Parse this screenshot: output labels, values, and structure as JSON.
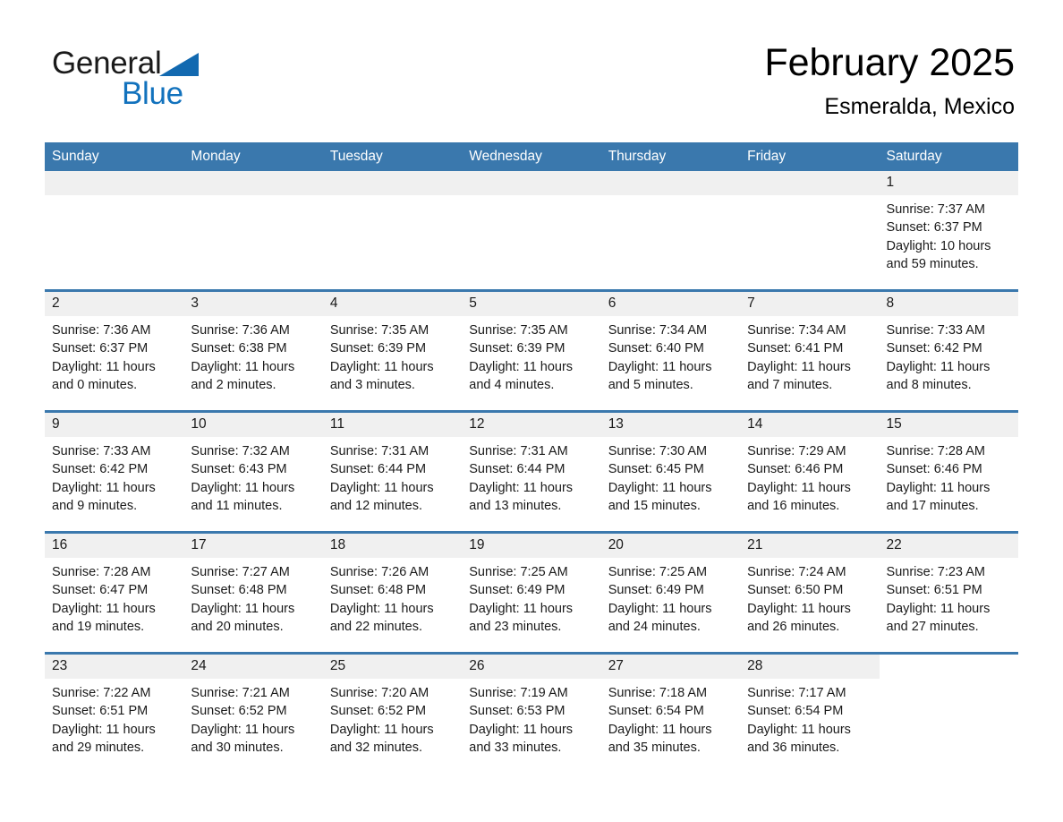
{
  "brand": {
    "word1": "General",
    "word2": "Blue",
    "triangle_color": "#1269b0",
    "blue_color": "#1272bd"
  },
  "header": {
    "title": "February 2025",
    "subtitle": "Esmeralda, Mexico"
  },
  "theme": {
    "header_blue": "#3a78ad",
    "daynum_gray": "#f0f0f0",
    "text": "#1a1a1a"
  },
  "weekday_headers": [
    "Sunday",
    "Monday",
    "Tuesday",
    "Wednesday",
    "Thursday",
    "Friday",
    "Saturday"
  ],
  "weeks": [
    [
      {
        "day": "",
        "blank": true
      },
      {
        "day": "",
        "blank": true
      },
      {
        "day": "",
        "blank": true
      },
      {
        "day": "",
        "blank": true
      },
      {
        "day": "",
        "blank": true
      },
      {
        "day": "",
        "blank": true
      },
      {
        "day": "1",
        "sunrise": "Sunrise: 7:37 AM",
        "sunset": "Sunset: 6:37 PM",
        "daylight_1": "Daylight: 10 hours",
        "daylight_2": "and 59 minutes."
      }
    ],
    [
      {
        "day": "2",
        "sunrise": "Sunrise: 7:36 AM",
        "sunset": "Sunset: 6:37 PM",
        "daylight_1": "Daylight: 11 hours",
        "daylight_2": "and 0 minutes."
      },
      {
        "day": "3",
        "sunrise": "Sunrise: 7:36 AM",
        "sunset": "Sunset: 6:38 PM",
        "daylight_1": "Daylight: 11 hours",
        "daylight_2": "and 2 minutes."
      },
      {
        "day": "4",
        "sunrise": "Sunrise: 7:35 AM",
        "sunset": "Sunset: 6:39 PM",
        "daylight_1": "Daylight: 11 hours",
        "daylight_2": "and 3 minutes."
      },
      {
        "day": "5",
        "sunrise": "Sunrise: 7:35 AM",
        "sunset": "Sunset: 6:39 PM",
        "daylight_1": "Daylight: 11 hours",
        "daylight_2": "and 4 minutes."
      },
      {
        "day": "6",
        "sunrise": "Sunrise: 7:34 AM",
        "sunset": "Sunset: 6:40 PM",
        "daylight_1": "Daylight: 11 hours",
        "daylight_2": "and 5 minutes."
      },
      {
        "day": "7",
        "sunrise": "Sunrise: 7:34 AM",
        "sunset": "Sunset: 6:41 PM",
        "daylight_1": "Daylight: 11 hours",
        "daylight_2": "and 7 minutes."
      },
      {
        "day": "8",
        "sunrise": "Sunrise: 7:33 AM",
        "sunset": "Sunset: 6:42 PM",
        "daylight_1": "Daylight: 11 hours",
        "daylight_2": "and 8 minutes."
      }
    ],
    [
      {
        "day": "9",
        "sunrise": "Sunrise: 7:33 AM",
        "sunset": "Sunset: 6:42 PM",
        "daylight_1": "Daylight: 11 hours",
        "daylight_2": "and 9 minutes."
      },
      {
        "day": "10",
        "sunrise": "Sunrise: 7:32 AM",
        "sunset": "Sunset: 6:43 PM",
        "daylight_1": "Daylight: 11 hours",
        "daylight_2": "and 11 minutes."
      },
      {
        "day": "11",
        "sunrise": "Sunrise: 7:31 AM",
        "sunset": "Sunset: 6:44 PM",
        "daylight_1": "Daylight: 11 hours",
        "daylight_2": "and 12 minutes."
      },
      {
        "day": "12",
        "sunrise": "Sunrise: 7:31 AM",
        "sunset": "Sunset: 6:44 PM",
        "daylight_1": "Daylight: 11 hours",
        "daylight_2": "and 13 minutes."
      },
      {
        "day": "13",
        "sunrise": "Sunrise: 7:30 AM",
        "sunset": "Sunset: 6:45 PM",
        "daylight_1": "Daylight: 11 hours",
        "daylight_2": "and 15 minutes."
      },
      {
        "day": "14",
        "sunrise": "Sunrise: 7:29 AM",
        "sunset": "Sunset: 6:46 PM",
        "daylight_1": "Daylight: 11 hours",
        "daylight_2": "and 16 minutes."
      },
      {
        "day": "15",
        "sunrise": "Sunrise: 7:28 AM",
        "sunset": "Sunset: 6:46 PM",
        "daylight_1": "Daylight: 11 hours",
        "daylight_2": "and 17 minutes."
      }
    ],
    [
      {
        "day": "16",
        "sunrise": "Sunrise: 7:28 AM",
        "sunset": "Sunset: 6:47 PM",
        "daylight_1": "Daylight: 11 hours",
        "daylight_2": "and 19 minutes."
      },
      {
        "day": "17",
        "sunrise": "Sunrise: 7:27 AM",
        "sunset": "Sunset: 6:48 PM",
        "daylight_1": "Daylight: 11 hours",
        "daylight_2": "and 20 minutes."
      },
      {
        "day": "18",
        "sunrise": "Sunrise: 7:26 AM",
        "sunset": "Sunset: 6:48 PM",
        "daylight_1": "Daylight: 11 hours",
        "daylight_2": "and 22 minutes."
      },
      {
        "day": "19",
        "sunrise": "Sunrise: 7:25 AM",
        "sunset": "Sunset: 6:49 PM",
        "daylight_1": "Daylight: 11 hours",
        "daylight_2": "and 23 minutes."
      },
      {
        "day": "20",
        "sunrise": "Sunrise: 7:25 AM",
        "sunset": "Sunset: 6:49 PM",
        "daylight_1": "Daylight: 11 hours",
        "daylight_2": "and 24 minutes."
      },
      {
        "day": "21",
        "sunrise": "Sunrise: 7:24 AM",
        "sunset": "Sunset: 6:50 PM",
        "daylight_1": "Daylight: 11 hours",
        "daylight_2": "and 26 minutes."
      },
      {
        "day": "22",
        "sunrise": "Sunrise: 7:23 AM",
        "sunset": "Sunset: 6:51 PM",
        "daylight_1": "Daylight: 11 hours",
        "daylight_2": "and 27 minutes."
      }
    ],
    [
      {
        "day": "23",
        "sunrise": "Sunrise: 7:22 AM",
        "sunset": "Sunset: 6:51 PM",
        "daylight_1": "Daylight: 11 hours",
        "daylight_2": "and 29 minutes."
      },
      {
        "day": "24",
        "sunrise": "Sunrise: 7:21 AM",
        "sunset": "Sunset: 6:52 PM",
        "daylight_1": "Daylight: 11 hours",
        "daylight_2": "and 30 minutes."
      },
      {
        "day": "25",
        "sunrise": "Sunrise: 7:20 AM",
        "sunset": "Sunset: 6:52 PM",
        "daylight_1": "Daylight: 11 hours",
        "daylight_2": "and 32 minutes."
      },
      {
        "day": "26",
        "sunrise": "Sunrise: 7:19 AM",
        "sunset": "Sunset: 6:53 PM",
        "daylight_1": "Daylight: 11 hours",
        "daylight_2": "and 33 minutes."
      },
      {
        "day": "27",
        "sunrise": "Sunrise: 7:18 AM",
        "sunset": "Sunset: 6:54 PM",
        "daylight_1": "Daylight: 11 hours",
        "daylight_2": "and 35 minutes."
      },
      {
        "day": "28",
        "sunrise": "Sunrise: 7:17 AM",
        "sunset": "Sunset: 6:54 PM",
        "daylight_1": "Daylight: 11 hours",
        "daylight_2": "and 36 minutes."
      },
      {
        "day": "",
        "blank": true
      }
    ]
  ]
}
